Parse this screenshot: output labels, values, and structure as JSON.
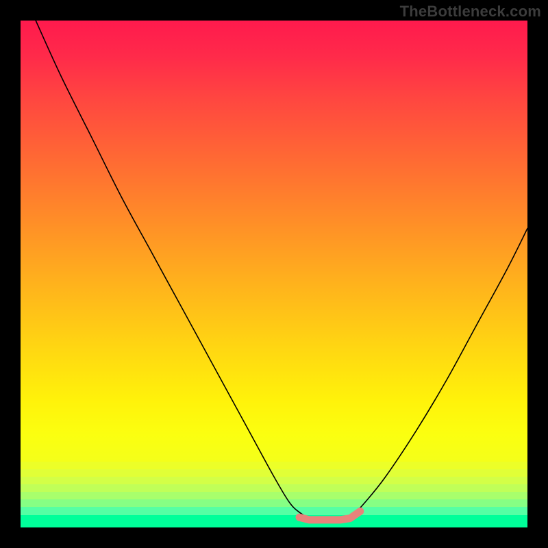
{
  "watermark": "TheBottleneck.com",
  "chart_data": {
    "type": "line",
    "title": "",
    "xlabel": "",
    "ylabel": "",
    "xlim": [
      0,
      100
    ],
    "ylim": [
      0,
      100
    ],
    "grid": false,
    "series": [
      {
        "name": "bottleneck-curve",
        "x": [
          3,
          8,
          14,
          20,
          26,
          32,
          38,
          44,
          50,
          53,
          55,
          57,
          60,
          62,
          64,
          66,
          68,
          72,
          78,
          84,
          90,
          96,
          100
        ],
        "y": [
          100,
          89,
          77,
          65,
          54,
          43,
          32,
          21,
          10,
          5,
          3,
          2,
          2,
          2,
          2,
          3,
          5,
          10,
          19,
          29,
          40,
          51,
          59
        ]
      },
      {
        "name": "bottleneck-flat-marker",
        "x": [
          55,
          57,
          59,
          61,
          63,
          65,
          67
        ],
        "y": [
          2,
          1.5,
          1.5,
          1.5,
          1.5,
          1.8,
          3.2
        ]
      }
    ],
    "background_gradient": {
      "stops": [
        {
          "pos": 0.0,
          "color": "#ff1a4d"
        },
        {
          "pos": 0.35,
          "color": "#ff7a2d"
        },
        {
          "pos": 0.7,
          "color": "#ffe413"
        },
        {
          "pos": 0.87,
          "color": "#f4ff1a"
        },
        {
          "pos": 0.885,
          "color": "#ecff28"
        },
        {
          "pos": 0.9,
          "color": "#e1ff37"
        },
        {
          "pos": 0.915,
          "color": "#d3ff47"
        },
        {
          "pos": 0.93,
          "color": "#c0ff58"
        },
        {
          "pos": 0.945,
          "color": "#a8ff6c"
        },
        {
          "pos": 0.96,
          "color": "#86ff84"
        },
        {
          "pos": 0.975,
          "color": "#55ffa4"
        },
        {
          "pos": 1.0,
          "color": "#00ff9a"
        }
      ]
    }
  }
}
